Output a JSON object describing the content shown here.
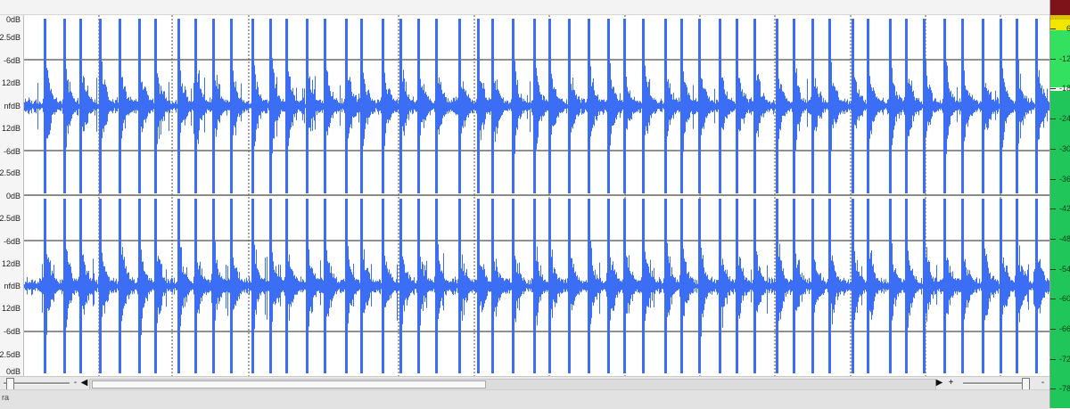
{
  "db_scale": {
    "channel_1": [
      "0dB",
      "2.5dB",
      "-6dB",
      "12dB",
      "nfdB",
      "12dB",
      "-6dB",
      "2.5dB",
      "0dB"
    ],
    "channel_2": [
      "2.5dB",
      "-6dB",
      "12dB",
      "nfdB",
      "12dB",
      "-6dB",
      "2.5dB",
      "0dB"
    ]
  },
  "waveform": {
    "color": "#3b6ef5",
    "gridline_color": "#222222",
    "marker_color": "#555555"
  },
  "bottom_bar": {
    "zoom_out_label": "-",
    "scroll_left_label": "◀",
    "scroll_right_label": "▶",
    "zoom_in_label": "+",
    "zoom_out_right_label": "-"
  },
  "status": {
    "text": "ra"
  },
  "level_meter": {
    "ticks": [
      "6",
      "-12",
      "-18",
      "-24",
      "-30",
      "-36",
      "-42",
      "-48",
      "-54",
      "-60",
      "-66",
      "-72",
      "-78"
    ],
    "colors": {
      "peak": "#7e1419",
      "warn": "#f2e600",
      "normal": "#20c65a"
    }
  }
}
